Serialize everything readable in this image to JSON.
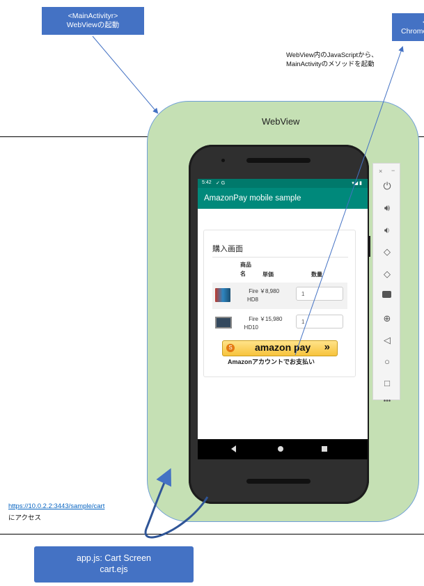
{
  "main_activity_box": {
    "line1": "<MainActivityr>",
    "line2": "WebViewの起動"
  },
  "chrome_box": {
    "text_partial": "<",
    "text_line2": "Chrome"
  },
  "annotation_js": {
    "line1": "WebView内のJavaScriptから、",
    "line2": "MainActivityのメソッドを起動"
  },
  "webview_label": "WebView",
  "cart_url": "https://10.0.2.2:3443/sample/cart",
  "access_label": "にアクセス",
  "app_box": {
    "line1": "app.js: Cart Screen",
    "line2": "cart.ejs"
  },
  "phone": {
    "status_time": "5:42",
    "status_icons": "✓ G",
    "status_right": "▾◢ ▮",
    "app_title": "AmazonPay mobile sample",
    "page_heading": "購入画面",
    "table_headers": {
      "product": "商品名",
      "price": "単価",
      "qty": "数量"
    },
    "rows": [
      {
        "name": "Fire HD8",
        "price": "￥8,980",
        "qty": "1"
      },
      {
        "name": "Fire HD10",
        "price": "￥15,980",
        "qty": "1"
      }
    ],
    "pay_button": {
      "logo_s": "S",
      "label": "amazon pay",
      "chevron": "»"
    },
    "pay_caption": "Amazonアカウントでお支払い"
  },
  "emulator": {
    "close": "×",
    "minimize": "−",
    "icons": [
      "power-icon",
      "volume-up-icon",
      "volume-down-icon",
      "rotate-left-icon",
      "rotate-right-icon",
      "camera-icon",
      "zoom-icon",
      "back-icon",
      "home-icon",
      "overview-icon",
      "more-icon"
    ]
  },
  "colors": {
    "box_blue": "#4472c4",
    "webview_green": "#c5e0b4",
    "appbar_teal": "#00897b",
    "arrow_blue": "#4472c4"
  }
}
